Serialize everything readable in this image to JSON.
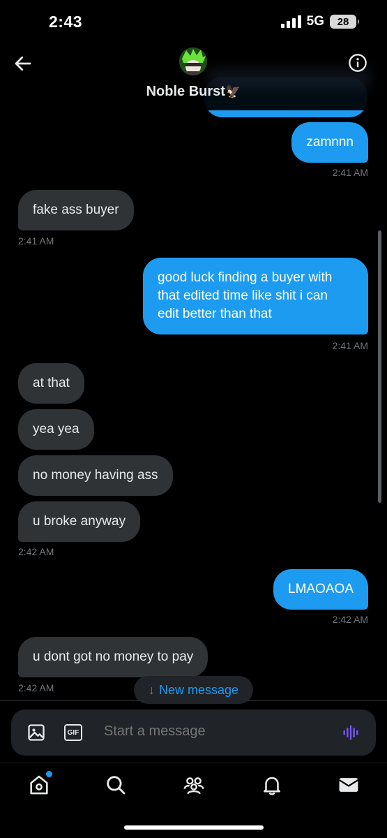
{
  "status": {
    "time": "2:43",
    "network": "5G",
    "battery": "28"
  },
  "header": {
    "contact_name": "Noble Burst",
    "contact_emoji": "🦅"
  },
  "messages": [
    {
      "side": "sent",
      "text": "zamnnn",
      "time": "2:41 AM"
    },
    {
      "side": "recv",
      "text": "fake ass buyer",
      "time": "2:41 AM"
    },
    {
      "side": "sent",
      "lines": [
        "good luck finding a buyer with",
        "that edited time like shit i can",
        "edit better than that"
      ],
      "time": "2:41 AM"
    },
    {
      "side": "recv",
      "text": "at that"
    },
    {
      "side": "recv",
      "text": "yea yea"
    },
    {
      "side": "recv",
      "text": "no money having ass"
    },
    {
      "side": "recv",
      "text": "u broke anyway",
      "time": "2:42 AM"
    },
    {
      "side": "sent",
      "text": "LMAOAOA",
      "time": "2:42 AM"
    },
    {
      "side": "recv",
      "text": "u dont got no money to pay",
      "time": "2:42 AM"
    }
  ],
  "new_message_label": "New message",
  "composer": {
    "placeholder": "Start a message",
    "gif_label": "GIF"
  },
  "nav": [
    "home-icon",
    "search-icon",
    "communities-icon",
    "notifications-icon",
    "messages-icon"
  ],
  "colors": {
    "accent": "#1d9bf0",
    "sent_bubble": "#1d9bf0",
    "received_bubble": "#2f3336",
    "background": "#000000",
    "timestamp": "#71767b"
  }
}
